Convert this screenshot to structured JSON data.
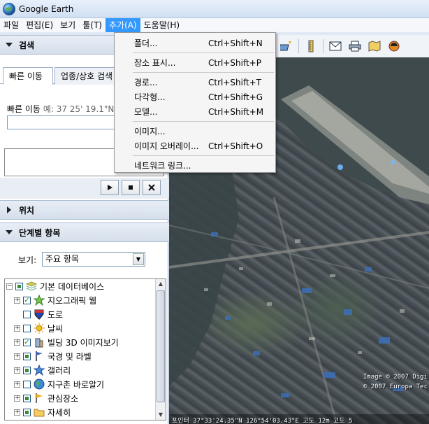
{
  "window": {
    "title": "Google Earth"
  },
  "menubar": [
    "파일",
    "편집(E)",
    "보기",
    "툴(T)",
    "추가(A)",
    "도움말(H)"
  ],
  "menubar_active_index": 4,
  "add_menu": {
    "groups": [
      [
        {
          "label": "폴더...",
          "shortcut": "Ctrl+Shift+N"
        }
      ],
      [
        {
          "label": "장소 표시...",
          "shortcut": "Ctrl+Shift+P"
        }
      ],
      [
        {
          "label": "경로...",
          "shortcut": "Ctrl+Shift+T"
        },
        {
          "label": "다각형...",
          "shortcut": "Ctrl+Shift+G"
        },
        {
          "label": "모델...",
          "shortcut": "Ctrl+Shift+M"
        }
      ],
      [
        {
          "label": "이미지...",
          "shortcut": ""
        },
        {
          "label": "이미지 오버레이...",
          "shortcut": "Ctrl+Shift+O"
        }
      ],
      [
        {
          "label": "네트워크 링크...",
          "shortcut": ""
        }
      ]
    ]
  },
  "search": {
    "header": "검색",
    "tabs": [
      "빠른 이동",
      "업종/상호 검색"
    ],
    "fly_to_label": "빠른 이동",
    "fly_to_example": "예: 37 25' 19.1\"N,",
    "fly_to_value": ""
  },
  "places": {
    "header": "위치"
  },
  "layers": {
    "header": "단계별 항목",
    "view_label": "보기:",
    "view_value": "주요 항목",
    "items": [
      {
        "label": "기본 데이터베이스",
        "icon": "layers-icon",
        "checked": "partial",
        "level": 0,
        "expander": "−"
      },
      {
        "label": "지오그래픽 웹",
        "icon": "star-icon",
        "checked": "checked",
        "level": 1,
        "expander": "+"
      },
      {
        "label": "도로",
        "icon": "road-shield-icon",
        "checked": "unchecked",
        "level": 1,
        "expander": ""
      },
      {
        "label": "날씨",
        "icon": "sun-icon",
        "checked": "unchecked",
        "level": 1,
        "expander": "+"
      },
      {
        "label": "빌딩 3D 이미지보기",
        "icon": "building-icon",
        "checked": "checked",
        "level": 1,
        "expander": "+"
      },
      {
        "label": "국경 및 라벨",
        "icon": "border-flag-icon",
        "checked": "partial",
        "level": 1,
        "expander": "+"
      },
      {
        "label": "갤러리",
        "icon": "star-blue-icon",
        "checked": "partial",
        "level": 1,
        "expander": "+"
      },
      {
        "label": "지구촌 바로알기",
        "icon": "globe-icon",
        "checked": "unchecked",
        "level": 1,
        "expander": "+"
      },
      {
        "label": "관심장소",
        "icon": "flag-icon",
        "checked": "partial",
        "level": 1,
        "expander": "+"
      },
      {
        "label": "자세히",
        "icon": "folder-icon",
        "checked": "partial",
        "level": 1,
        "expander": "+"
      }
    ]
  },
  "map": {
    "copyright_1": "Image © 2007 Digi",
    "copyright_2": "© 2007 Europa Tec",
    "status": "포인터 37°33'24.35\"N 126°54'03.43\"E 고도 12m 고도 5"
  }
}
